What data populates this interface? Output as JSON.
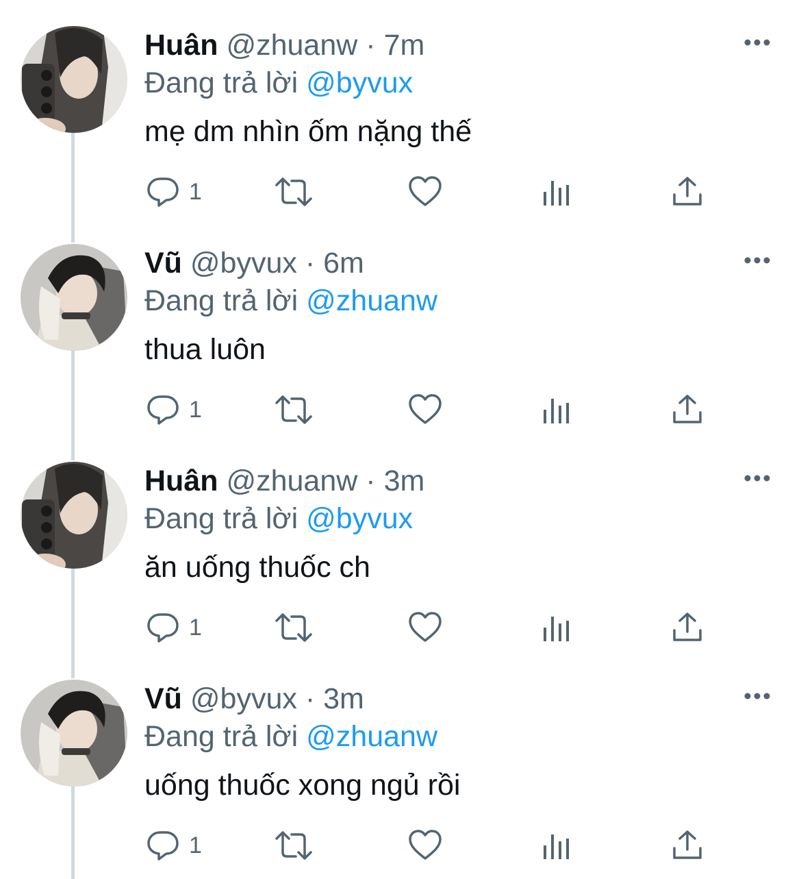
{
  "tweets": [
    {
      "name": "Huân",
      "handle": "@zhuanw",
      "separator": "·",
      "time": "7m",
      "reply_prefix": "Đang trả lời",
      "reply_to": "@byvux",
      "text": "mẹ dm nhìn ốm nặng thế",
      "reply_count": "1",
      "avatar_icon": "profile-photo-huan",
      "icons": [
        "reply-icon",
        "retweet-icon",
        "like-icon",
        "views-icon",
        "share-icon",
        "more-icon"
      ]
    },
    {
      "name": "Vũ",
      "handle": "@byvux",
      "separator": "·",
      "time": "6m",
      "reply_prefix": "Đang trả lời",
      "reply_to": "@zhuanw",
      "text": "thua luôn",
      "reply_count": "1",
      "avatar_icon": "profile-photo-vu",
      "icons": [
        "reply-icon",
        "retweet-icon",
        "like-icon",
        "views-icon",
        "share-icon",
        "more-icon"
      ]
    },
    {
      "name": "Huân",
      "handle": "@zhuanw",
      "separator": "·",
      "time": "3m",
      "reply_prefix": "Đang trả lời",
      "reply_to": "@byvux",
      "text": "ăn uống thuốc ch",
      "reply_count": "1",
      "avatar_icon": "profile-photo-huan",
      "icons": [
        "reply-icon",
        "retweet-icon",
        "like-icon",
        "views-icon",
        "share-icon",
        "more-icon"
      ]
    },
    {
      "name": "Vũ",
      "handle": "@byvux",
      "separator": "·",
      "time": "3m",
      "reply_prefix": "Đang trả lời",
      "reply_to": "@zhuanw",
      "text": "uống thuốc xong ngủ rồi",
      "reply_count": "1",
      "avatar_icon": "profile-photo-vu",
      "icons": [
        "reply-icon",
        "retweet-icon",
        "like-icon",
        "views-icon",
        "share-icon",
        "more-icon"
      ]
    }
  ],
  "colors": {
    "text_primary": "#0f1419",
    "text_secondary": "#536471",
    "accent": "#1d9bf0",
    "thread_line": "#cfd9de",
    "icon": "#536471"
  }
}
